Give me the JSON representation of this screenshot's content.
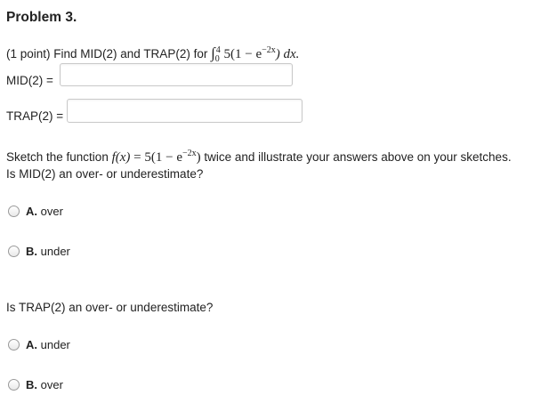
{
  "problem": {
    "title": "Problem 3.",
    "prompt_prefix": "(1 point) Find MID(2) and TRAP(2) for",
    "integral": {
      "lower": "0",
      "upper": "4",
      "integrand": "5(1 − e",
      "exp": "−2x",
      "close": ") dx."
    }
  },
  "fields": {
    "mid_label": "MID(2) =",
    "mid_value": "",
    "trap_label": "TRAP(2) =",
    "trap_value": ""
  },
  "sketch": {
    "prefix": "Sketch the function",
    "func_lhs": "f(x)",
    "func_rhs": " = 5(1 − e",
    "exp": "−2x",
    "func_close": ")",
    "suffix": " twice and illustrate your answers above on your sketches.",
    "question1": "Is MID(2) an over- or underestimate?"
  },
  "q1_options": [
    {
      "letter": "A.",
      "text": "over"
    },
    {
      "letter": "B.",
      "text": "under"
    }
  ],
  "question2": "Is TRAP(2) an over- or underestimate?",
  "q2_options": [
    {
      "letter": "A.",
      "text": "under"
    },
    {
      "letter": "B.",
      "text": "over"
    }
  ]
}
